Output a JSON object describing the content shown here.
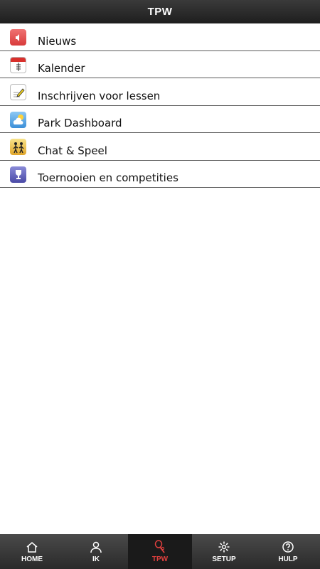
{
  "header": {
    "title": "TPW"
  },
  "menu": {
    "items": [
      {
        "label": "Nieuws",
        "icon": "speaker-icon"
      },
      {
        "label": "Kalender",
        "icon": "calendar-icon"
      },
      {
        "label": "Inschrijven voor lessen",
        "icon": "edit-icon"
      },
      {
        "label": "Park Dashboard",
        "icon": "weather-icon"
      },
      {
        "label": "Chat & Speel",
        "icon": "players-icon"
      },
      {
        "label": "Toernooien en competities",
        "icon": "trophy-icon"
      }
    ]
  },
  "tabbar": {
    "tabs": [
      {
        "label": "HOME",
        "icon": "home-icon",
        "active": false
      },
      {
        "label": "IK",
        "icon": "user-icon",
        "active": false
      },
      {
        "label": "TPW",
        "icon": "tennis-racket-icon",
        "active": true
      },
      {
        "label": "SETUP",
        "icon": "gear-icon",
        "active": false
      },
      {
        "label": "HULP",
        "icon": "help-icon",
        "active": false
      }
    ]
  },
  "colors": {
    "active_tab": "#e0403e",
    "bar": "#2a2a2a"
  }
}
